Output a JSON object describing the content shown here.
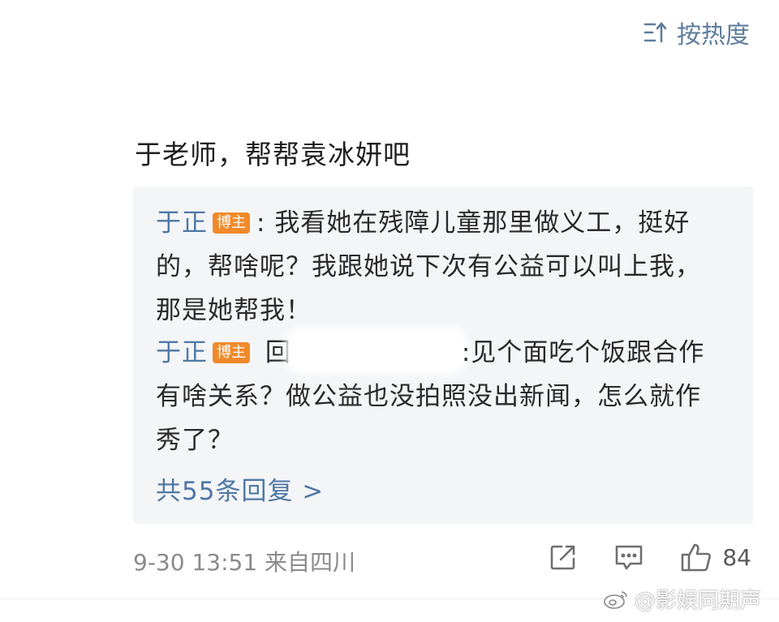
{
  "sort": {
    "label": "按热度",
    "icon": "sort-descending-icon"
  },
  "comment": {
    "text": "于老师，帮帮袁冰妍吧"
  },
  "replies": [
    {
      "user": "于正",
      "badge": "博主",
      "separator": ":",
      "text": "我看她在残障儿童那里做义工，挺好的，帮啥呢？我跟她说下次有公益可以叫上我，那是她帮我！"
    },
    {
      "user": "于正",
      "badge": "博主",
      "prefix": "回",
      "text": ":见个面吃个饭跟合作有啥关系？做公益也没拍照没出新闻，怎么就作秀了？"
    }
  ],
  "more_replies": {
    "label": "共55条回复 >"
  },
  "meta": {
    "date_time": "9-30 13:51",
    "location": "来自四川"
  },
  "actions": {
    "share_icon": "share-icon",
    "comment_icon": "comment-icon",
    "like_icon": "thumbs-up-icon",
    "like_count": "84"
  },
  "watermark": {
    "text": "@影娱同期声"
  },
  "colors": {
    "link_blue": "#4f78a5",
    "badge_orange": "#f08a2b",
    "reply_bg": "#f4f5f7",
    "meta_gray": "#8a8a8a"
  }
}
